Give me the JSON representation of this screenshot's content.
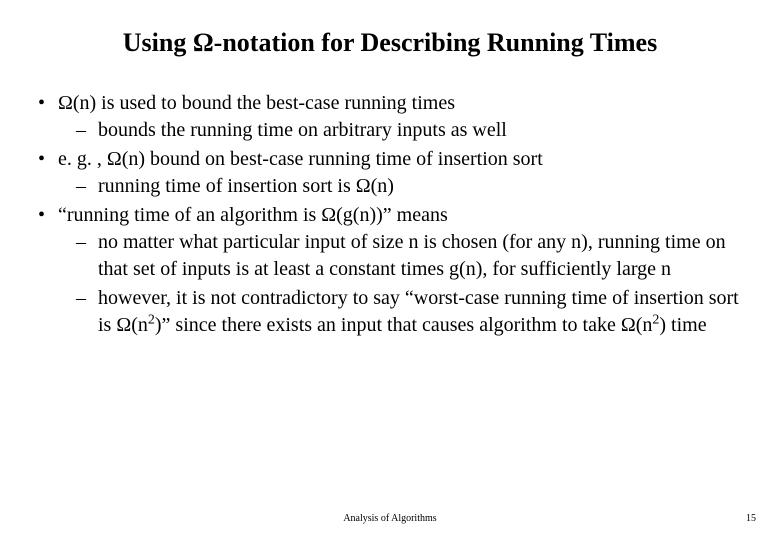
{
  "title": "Using Ω-notation for Describing Running Times",
  "bullets": {
    "b1": "Ω(n) is used to bound the best-case running times",
    "b1a": "bounds the running time on arbitrary inputs as well",
    "b2": "e. g. , Ω(n) bound on best-case running time of insertion sort",
    "b2a": "running time of insertion sort is Ω(n)",
    "b3": "“running time of an algorithm is Ω(g(n))” means",
    "b3a": "no matter what particular input of size n is chosen (for any n), running time on that set of inputs is at least a constant times g(n), for sufficiently large n",
    "b3b_pre": "however, it is not contradictory to say “worst-case running time of insertion sort is Ω(n",
    "b3b_sup1": "2",
    "b3b_mid": ")” since there exists an input that causes algorithm to take Ω(n",
    "b3b_sup2": "2",
    "b3b_post": ") time"
  },
  "footer": "Analysis of Algorithms",
  "page": "15"
}
